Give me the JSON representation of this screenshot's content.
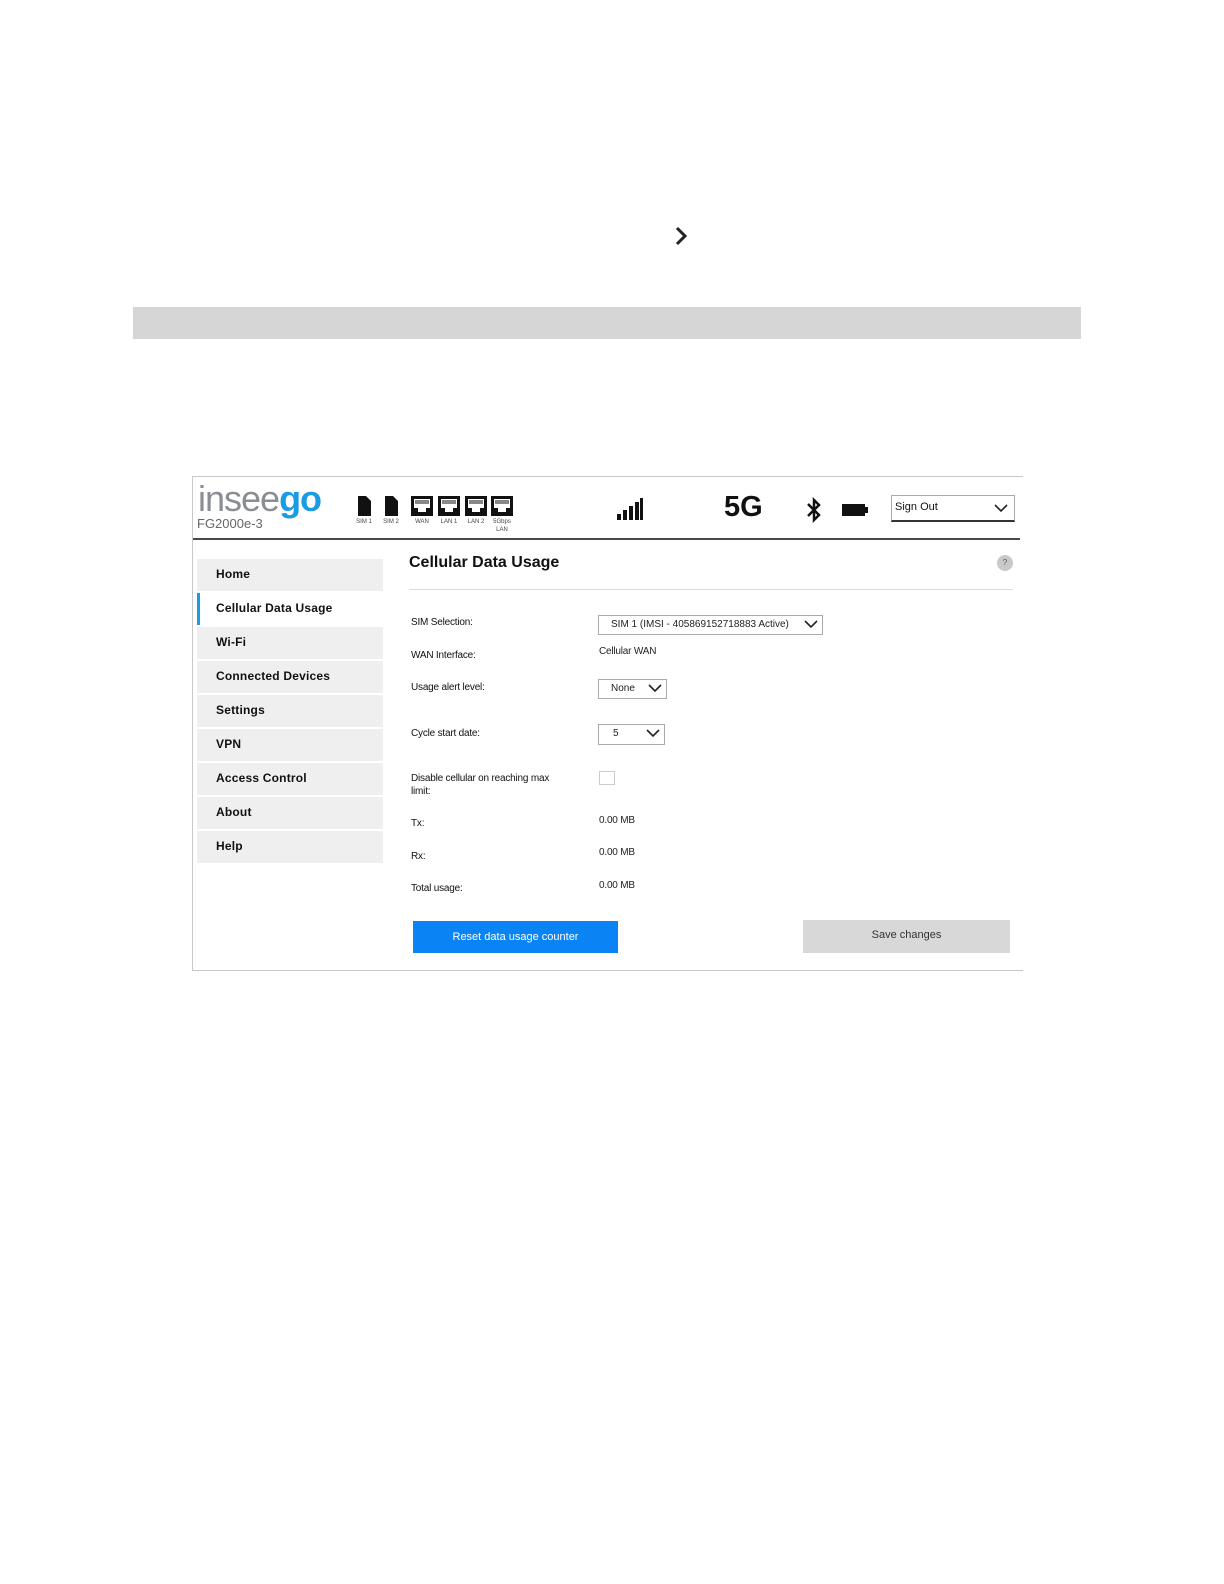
{
  "header": {
    "brand_part1": "insee",
    "brand_part2": "go",
    "model": "FG2000e-3",
    "status_icons": {
      "sim1": "SIM 1",
      "sim2": "SIM 2",
      "wan": "WAN",
      "lan1": "LAN 1",
      "lan2": "LAN 2",
      "lan5g_line1": "5Gbps",
      "lan5g_line2": "LAN"
    },
    "network_type": "5G",
    "sign_out": "Sign Out",
    "icon_names": [
      "chevron-right-icon",
      "sim-card-icon",
      "ethernet-port-icon",
      "signal-bars-icon",
      "bluetooth-icon",
      "battery-icon",
      "chevron-down-icon",
      "help-icon"
    ]
  },
  "colors": {
    "accent": "#1a9be6",
    "primary_button": "#0a84f5",
    "secondary_button": "#d8d8d8",
    "nav_background": "#efefef",
    "header_band": "#d6d6d6"
  },
  "nav": {
    "items": [
      {
        "label": "Home",
        "active": false
      },
      {
        "label": "Cellular Data Usage",
        "active": true
      },
      {
        "label": "Wi-Fi",
        "active": false
      },
      {
        "label": "Connected Devices",
        "active": false
      },
      {
        "label": "Settings",
        "active": false
      },
      {
        "label": "VPN",
        "active": false
      },
      {
        "label": "Access Control",
        "active": false
      },
      {
        "label": "About",
        "active": false
      },
      {
        "label": "Help",
        "active": false
      }
    ]
  },
  "main": {
    "title": "Cellular Data Usage",
    "help": "?",
    "fields": {
      "sim_selection": {
        "label": "SIM Selection:",
        "value": "SIM 1 (IMSI - 405869152718883 Active)"
      },
      "wan_interface": {
        "label": "WAN Interface:",
        "value": "Cellular WAN"
      },
      "usage_alert": {
        "label": "Usage alert level:",
        "value": "None"
      },
      "cycle_start": {
        "label": "Cycle start date:",
        "value": "5"
      },
      "disable_cellular": {
        "label_line1": "Disable cellular on reaching max",
        "label_line2": "limit:",
        "checked": false
      },
      "tx": {
        "label": "Tx:",
        "value": "0.00 MB"
      },
      "rx": {
        "label": "Rx:",
        "value": "0.00 MB"
      },
      "total": {
        "label": "Total usage:",
        "value": "0.00 MB"
      }
    },
    "reset_button": "Reset data usage counter",
    "save_button": "Save changes"
  }
}
